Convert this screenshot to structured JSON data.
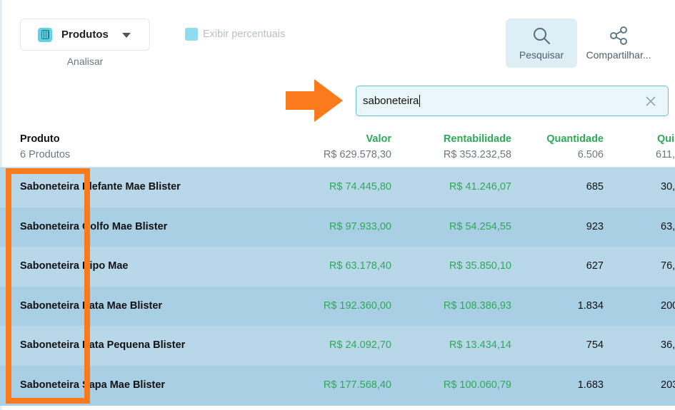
{
  "toolbar": {
    "dimension_label": "Produtos",
    "dimension_caption": "Analisar",
    "percent_toggle_label": "Exibir percentuais",
    "search_label": "Pesquisar",
    "share_label": "Compartilhar..."
  },
  "search": {
    "value": "saboneteira"
  },
  "colors": {
    "accent": "#5ed3e6",
    "positive": "#2eaa56",
    "highlight": "#fa7a1c",
    "row_a": "#b8d8ea",
    "row_b": "#a9cfe5"
  },
  "table": {
    "columns": [
      {
        "title": "Produto",
        "total": "6 Produtos"
      },
      {
        "title": "Valor",
        "total": "R$ 629.578,30"
      },
      {
        "title": "Rentabilidade",
        "total": "R$ 353.232,58"
      },
      {
        "title": "Quantidade",
        "total": "6.506"
      },
      {
        "title": "Quil",
        "total": "611,"
      }
    ],
    "rows": [
      {
        "produto": "Saboneteira Elefante Mae Blister",
        "valor": "R$ 74.445,80",
        "rentabilidade": "R$ 41.246,07",
        "quantidade": "685",
        "quilos": "30,"
      },
      {
        "produto": "Saboneteira Golfo Mae Blister",
        "valor": "R$ 97.933,00",
        "rentabilidade": "R$ 54.254,55",
        "quantidade": "923",
        "quilos": "63,"
      },
      {
        "produto": "Saboneteira Hipo Mae",
        "valor": "R$ 63.178,40",
        "rentabilidade": "R$ 35.850,10",
        "quantidade": "627",
        "quilos": "76,"
      },
      {
        "produto": "Saboneteira Pata Mae Blister",
        "valor": "R$ 192.360,00",
        "rentabilidade": "R$ 108.386,93",
        "quantidade": "1.834",
        "quilos": "200,"
      },
      {
        "produto": "Saboneteira Pata Pequena Blister",
        "valor": "R$ 24.092,70",
        "rentabilidade": "R$ 13.434,14",
        "quantidade": "754",
        "quilos": "36,"
      },
      {
        "produto": "Saboneteira Sapa Mae Blister",
        "valor": "R$ 177.568,40",
        "rentabilidade": "R$ 100.060,79",
        "quantidade": "1.683",
        "quilos": "203,"
      }
    ]
  }
}
